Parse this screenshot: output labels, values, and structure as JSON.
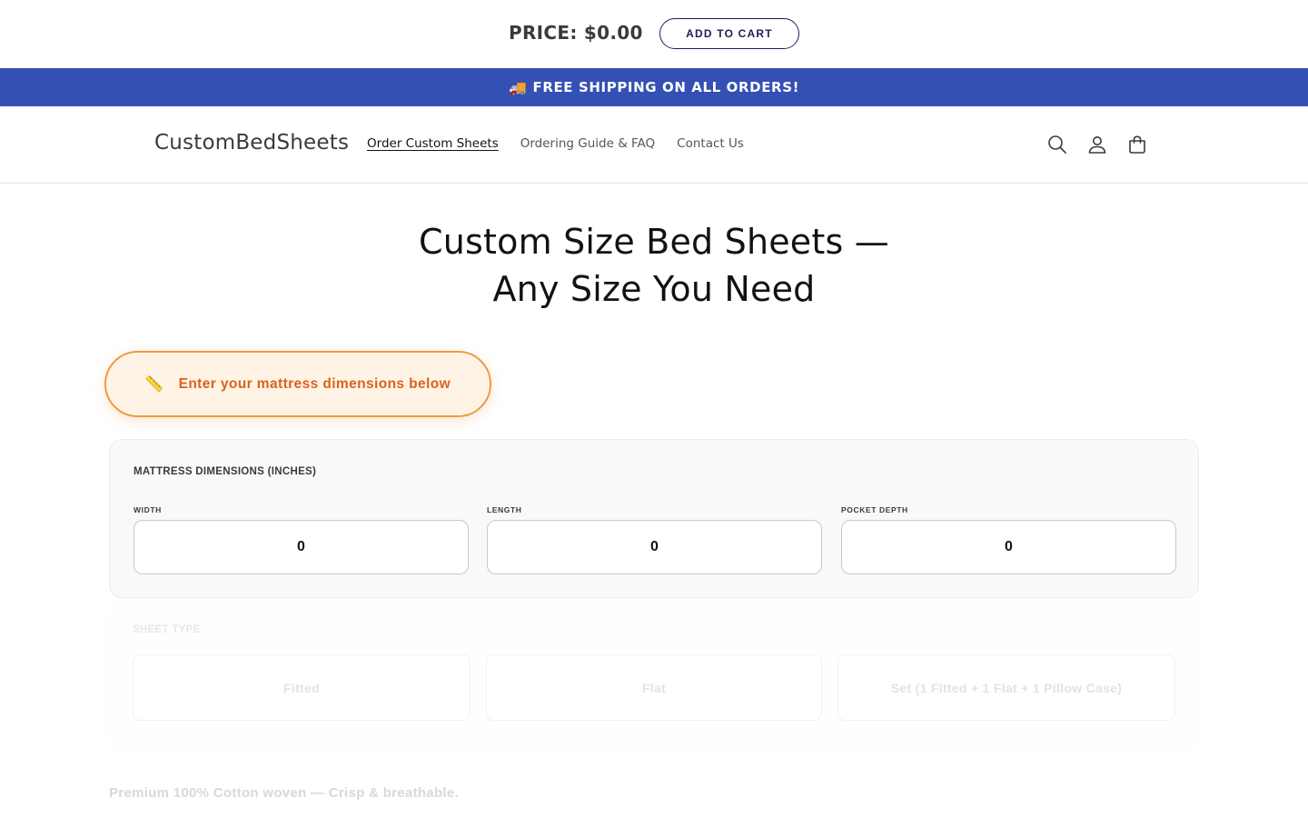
{
  "price_bar": {
    "price_text": "PRICE: $0.00",
    "add_to_cart_label": "ADD TO CART"
  },
  "announcement": {
    "icon": "🚚",
    "text": "FREE SHIPPING ON ALL ORDERS!",
    "background": "#3450b4"
  },
  "header": {
    "logo": "CustomBedSheets",
    "nav": [
      {
        "label": "Order Custom Sheets",
        "active": true
      },
      {
        "label": "Ordering Guide & FAQ",
        "active": false
      },
      {
        "label": "Contact Us",
        "active": false
      }
    ],
    "icons": [
      "search-icon",
      "account-icon",
      "cart-icon"
    ]
  },
  "main": {
    "title": "Custom Size Bed Sheets — Any Size You Need",
    "hint": {
      "icon": "📏",
      "text": "Enter your mattress dimensions below",
      "accent": "#f09a44"
    },
    "dimensions": {
      "heading": "MATTRESS DIMENSIONS (INCHES)",
      "fields": [
        {
          "label": "WIDTH",
          "value": "0"
        },
        {
          "label": "LENGTH",
          "value": "0"
        },
        {
          "label": "POCKET DEPTH",
          "value": "0"
        }
      ]
    },
    "sheet_type": {
      "heading": "SHEET TYPE",
      "options": [
        "Fitted",
        "Flat",
        "Set (1 Fitted + 1 Flat + 1 Pillow Case)"
      ]
    },
    "material_note": "Premium 100% Cotton woven — Crisp & breathable."
  }
}
